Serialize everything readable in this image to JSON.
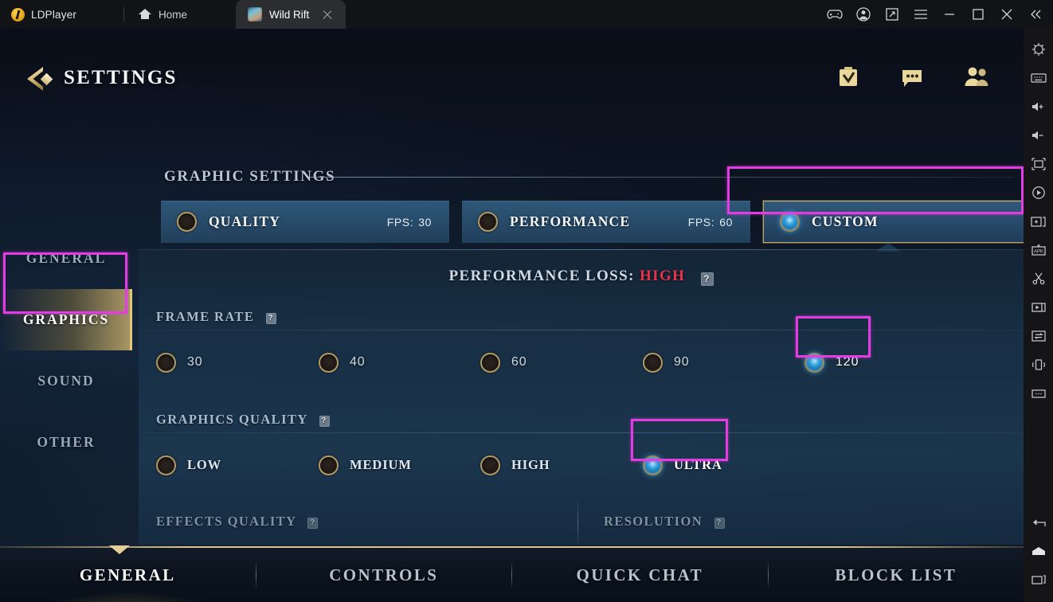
{
  "window": {
    "brand": "LDPlayer",
    "tabs": [
      {
        "label": "Home",
        "icon": "home-icon",
        "active": false
      },
      {
        "label": "Wild Rift",
        "icon": "game-icon",
        "active": true
      }
    ],
    "controls": [
      "gamepad-icon",
      "account-icon",
      "resize-icon",
      "menu-icon",
      "minimize-icon",
      "maximize-icon",
      "close-icon",
      "collapse-icon"
    ]
  },
  "right_toolbar": {
    "top_icons": [
      "settings-gear-icon",
      "keyboard-icon",
      "volume-up-icon",
      "volume-down-icon",
      "fullscreen-icon",
      "rotate-icon",
      "multi-instance-icon",
      "install-apk-icon",
      "scissors-icon",
      "video-record-icon",
      "file-transfer-icon",
      "shake-icon",
      "more-options-icon"
    ],
    "bottom_icons": [
      "back-icon",
      "home-icon",
      "recents-icon"
    ]
  },
  "game": {
    "header": {
      "title": "SETTINGS",
      "back_icon": "back-arrow-icon",
      "icons": [
        "mission-checklist-icon",
        "chat-icon",
        "friends-icon"
      ]
    },
    "sidebar": {
      "items": [
        {
          "label": "GENERAL",
          "active": false
        },
        {
          "label": "GRAPHICS",
          "active": true
        },
        {
          "label": "SOUND",
          "active": false
        },
        {
          "label": "OTHER",
          "active": false
        }
      ]
    },
    "section": {
      "title": "GRAPHIC SETTINGS"
    },
    "presets": [
      {
        "label": "QUALITY",
        "fps_label": "FPS:",
        "fps_value": "30",
        "selected": false
      },
      {
        "label": "PERFORMANCE",
        "fps_label": "FPS:",
        "fps_value": "60",
        "selected": false
      },
      {
        "label": "CUSTOM",
        "fps_label": "",
        "fps_value": "",
        "selected": true
      }
    ],
    "performance_loss": {
      "label": "PERFORMANCE LOSS:",
      "value": "HIGH",
      "help": "?"
    },
    "groups": [
      {
        "title": "FRAME RATE",
        "help": "?",
        "options": [
          {
            "label": "30",
            "selected": false
          },
          {
            "label": "40",
            "selected": false
          },
          {
            "label": "60",
            "selected": false
          },
          {
            "label": "90",
            "selected": false
          },
          {
            "label": "120",
            "selected": true
          }
        ]
      },
      {
        "title": "GRAPHICS QUALITY",
        "help": "?",
        "options": [
          {
            "label": "LOW",
            "selected": false
          },
          {
            "label": "MEDIUM",
            "selected": false
          },
          {
            "label": "HIGH",
            "selected": false
          },
          {
            "label": "ULTRA",
            "selected": true
          }
        ]
      },
      {
        "title": "EFFECTS QUALITY",
        "help": "?",
        "options": []
      },
      {
        "title": "RESOLUTION",
        "help": "?",
        "options": []
      }
    ],
    "bottom_tabs": [
      {
        "label": "GENERAL",
        "active": true
      },
      {
        "label": "CONTROLS",
        "active": false
      },
      {
        "label": "QUICK CHAT",
        "active": false
      },
      {
        "label": "BLOCK LIST",
        "active": false
      }
    ]
  },
  "annotations": {
    "color": "#e23ce2",
    "targets": [
      "sidebar-item-graphics",
      "preset-custom",
      "frame-rate-120",
      "graphics-quality-ultra"
    ]
  }
}
